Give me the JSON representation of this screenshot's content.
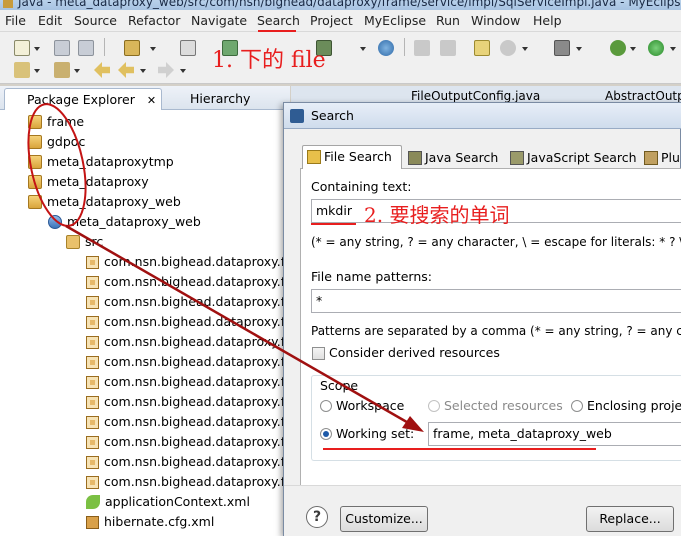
{
  "window": {
    "title": "Java - meta_dataproxy_web/src/com/nsn/bighead/dataproxy/frame/service/impl/SqlServiceImpl.java - MyEclipse E"
  },
  "menubar": {
    "items": [
      "File",
      "Edit",
      "Source",
      "Refactor",
      "Navigate",
      "Search",
      "Project",
      "MyEclipse",
      "Run",
      "Window",
      "Help"
    ]
  },
  "explorer": {
    "tabs": [
      "Package Explorer",
      "Hierarchy"
    ],
    "projects": [
      "frame",
      "gdpoc",
      "meta_dataproxytmp",
      "meta_dataproxy",
      "meta_dataproxy_web"
    ],
    "web_project": "meta_dataproxy_web",
    "src": "src",
    "packages": [
      "com.nsn.bighead.dataproxy.fra",
      "com.nsn.bighead.dataproxy.fra",
      "com.nsn.bighead.dataproxy.fra",
      "com.nsn.bighead.dataproxy.fra",
      "com.nsn.bighead.dataproxy.fra",
      "com.nsn.bighead.dataproxy.fra",
      "com.nsn.bighead.dataproxy.fra",
      "com.nsn.bighead.dataproxy.fra",
      "com.nsn.bighead.dataproxy.fra",
      "com.nsn.bighead.dataproxy.fra",
      "com.nsn.bighead.dataproxy.fra",
      "com.nsn.bighead.dataproxy.fra"
    ],
    "files": [
      "applicationContext.xml",
      "hibernate.cfg.xml"
    ]
  },
  "editor": {
    "tabs": [
      "FileOutputConfig.java",
      "AbstractOutp"
    ]
  },
  "dialog": {
    "title": "Search",
    "tabs": [
      "File Search",
      "Java Search",
      "JavaScript Search",
      "Plu"
    ],
    "containing_label": "Containing text:",
    "containing_value": "mkdir",
    "containing_hint": "(* = any string, ? = any character, \\ = escape for literals: * ? \\)",
    "patterns_label": "File name patterns:",
    "patterns_value": "*",
    "patterns_hint": "Patterns are separated by a comma (* = any string, ? = any cha",
    "derived_label": "Consider derived resources",
    "scope_label": "Scope",
    "scope_workspace": "Workspace",
    "scope_selected": "Selected resources",
    "scope_enclosing": "Enclosing projec",
    "working_set_label": "Working set:",
    "working_set_value": "frame, meta_dataproxy_web",
    "help": "?",
    "customize": "Customize...",
    "replace": "Replace..."
  },
  "annotations": {
    "step1": "1. 下的 file",
    "step2": "2. 要搜索的单词"
  },
  "colors": {
    "annotation": "#e81e1e",
    "arrow": "#a01010"
  }
}
